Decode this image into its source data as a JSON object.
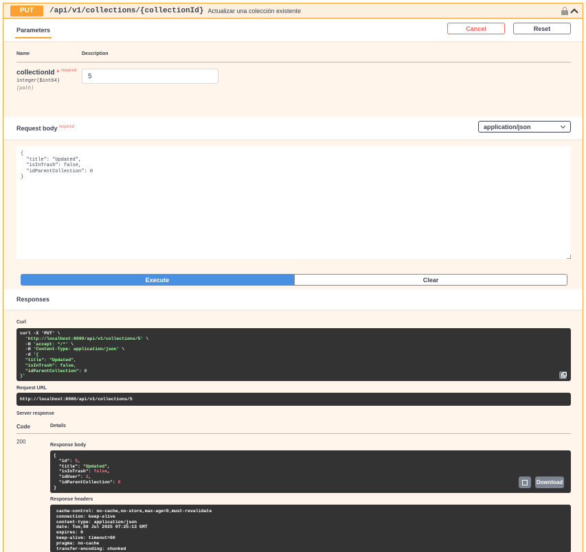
{
  "summary": {
    "method": "PUT",
    "path": "/api/v1/collections/{collectionId}",
    "description": "Actualizar una colección existente"
  },
  "parameters": {
    "tab_label": "Parameters",
    "cancel_label": "Cancel",
    "reset_label": "Reset",
    "col_name": "Name",
    "col_description": "Description",
    "param": {
      "name": "collectionId",
      "required_star": "*",
      "required_label": "required",
      "type": "integer($int64)",
      "location": "(path)",
      "value": "5"
    }
  },
  "request_body": {
    "title": "Request body",
    "required_label": "required",
    "content_type": "application/json",
    "text": "{\n  \"title\": \"Updated\",\n  \"isInTrash\": false,\n  \"idParentCollection\": 0\n}",
    "execute_label": "Execute",
    "clear_label": "Clear"
  },
  "responses": {
    "title": "Responses",
    "curl_label": "Curl",
    "curl_lines": [
      {
        "text": "curl -X 'PUT' \\",
        "cls": ""
      },
      {
        "text": "  'http://localhost:8080/api/v1/collections/5' \\",
        "cls": "green",
        "prefix": "  ",
        "body": "'http://localhost:8080/api/v1/collections/5'",
        "suffix": " \\"
      },
      {
        "text": "  -H 'accept: */*' \\"
      },
      {
        "text": "  -H 'Content-Type: application/json' \\"
      },
      {
        "text": "  -d '{"
      },
      {
        "text": "  \"title\": \"Updated\","
      },
      {
        "text": "  \"isInTrash\": false,"
      },
      {
        "text": "  \"idParentCollection\": 0"
      },
      {
        "text": "}'"
      }
    ],
    "request_url_label": "Request URL",
    "request_url": "http://localhost:8080/api/v1/collections/5",
    "server_response_label": "Server response",
    "col_code": "Code",
    "col_details": "Details",
    "code": "200",
    "response_body_label": "Response body",
    "download_label": "Download",
    "response_headers_label": "Response headers",
    "headers_text": "cache-control: no-cache,no-store,max-age=0,must-revalidate\nconnection: keep-alive\ncontent-type: application/json\ndate: Tue,08 Jul 2025 07:25:13 GMT\nexpires: 0\nkeep-alive: timeout=60\npragma: no-cache\ntransfer-encoding: chunked"
  }
}
